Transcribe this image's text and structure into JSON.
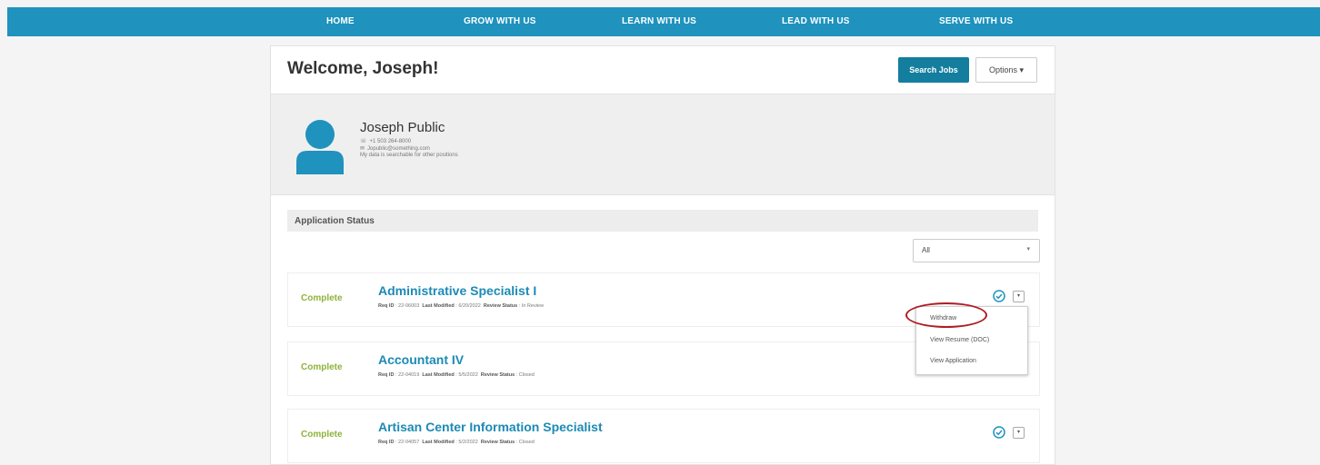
{
  "nav": {
    "items": [
      "HOME",
      "GROW WITH US",
      "LEARN WITH US",
      "LEAD WITH US",
      "SERVE WITH US"
    ]
  },
  "header": {
    "welcome": "Welcome, Joseph!",
    "search_label": "Search Jobs",
    "options_label": "Options ▾"
  },
  "profile": {
    "name": "Joseph Public",
    "phone": "+1 503 264-8000",
    "email": "Jopublic@something.com",
    "searchable_note": "My data is searchable for other positions"
  },
  "applications": {
    "section_title": "Application Status",
    "filter_value": "All",
    "labels": {
      "req_id": "Req ID",
      "last_modified": "Last Modified",
      "review_status": "Review Status"
    },
    "items": [
      {
        "status": "Complete",
        "title": "Administrative Specialist I",
        "req_id": "22-06003",
        "last_modified": "6/20/2022",
        "review_status": "In Review"
      },
      {
        "status": "Complete",
        "title": "Accountant IV",
        "req_id": "22-04019",
        "last_modified": "5/5/2022",
        "review_status": "Closed"
      },
      {
        "status": "Complete",
        "title": "Artisan Center Information Specialist",
        "req_id": "22-04057",
        "last_modified": "5/2/2022",
        "review_status": "Closed"
      }
    ]
  },
  "menu": {
    "items": [
      "Withdraw",
      "View Resume (DOC)",
      "View Application"
    ]
  },
  "colors": {
    "nav_bg": "#1f92be",
    "primary_button": "#137e9e",
    "status_complete": "#8fb23b",
    "job_title": "#1c8ab6",
    "highlight_ring": "#b01c24"
  },
  "icons": {
    "avatar": "user-silhouette-icon",
    "phone": "phone-icon",
    "email": "envelope-icon",
    "check": "check-circle-icon",
    "more": "caret-down-icon"
  }
}
